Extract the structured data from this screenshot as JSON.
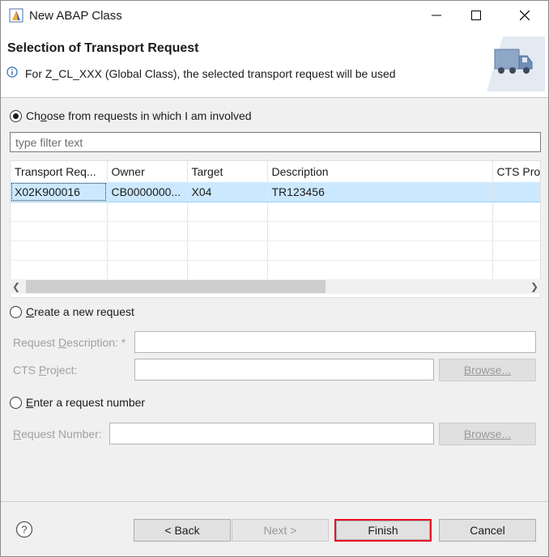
{
  "window": {
    "title": "New ABAP Class"
  },
  "banner": {
    "title": "Selection of Transport Request",
    "message": "For Z_CL_XXX (Global Class), the selected transport request will be used"
  },
  "choose": {
    "label_pre": "Ch",
    "label_underline": "o",
    "label_post": "ose from requests in which I am involved",
    "selected": true
  },
  "filter": {
    "placeholder": "type filter text",
    "value": ""
  },
  "table": {
    "columns": [
      "Transport Req...",
      "Owner",
      "Target",
      "Description",
      "CTS Proj"
    ],
    "rows": [
      [
        "X02K900016",
        "CB0000000...",
        "X04",
        "TR123456",
        ""
      ]
    ]
  },
  "create": {
    "label_underline": "C",
    "label_post": "reate a new request",
    "request_description_label_pre": "Request ",
    "request_description_label_underline": "D",
    "request_description_label_post": "escription: *",
    "cts_project_label_pre": "CTS ",
    "cts_project_label_underline": "P",
    "cts_project_label_post": "roject:",
    "browse_label": "Browse..."
  },
  "enter": {
    "label_underline": "E",
    "label_post": "nter a request number",
    "request_number_label_pre": "",
    "request_number_label_underline": "R",
    "request_number_label_post": "equest Number:",
    "browse_label": "Browse..."
  },
  "footer": {
    "back_label": "< Back",
    "next_label": "Next >",
    "finish_label": "Finish",
    "cancel_label": "Cancel"
  },
  "colors": {
    "selection": "#cce8ff",
    "highlight_border": "#e81123"
  }
}
